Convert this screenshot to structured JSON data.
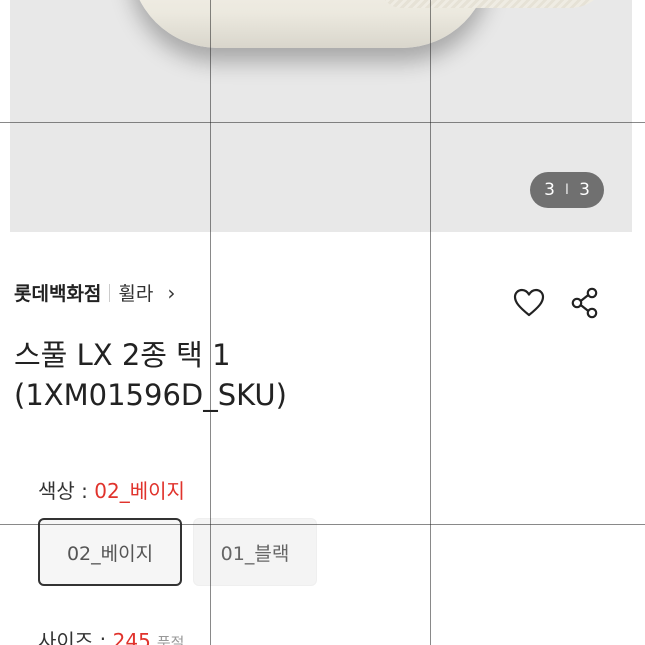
{
  "gallery": {
    "image_alt": "beige slipper product photo",
    "pager": {
      "current": "3",
      "separator": "I",
      "total": "3"
    }
  },
  "product": {
    "brand": "롯데백화점",
    "sub_brand": "휠라",
    "brand_chevron": "›",
    "title_line1": "스풀 LX 2종 택 1",
    "title_line2": "(1XM01596D_SKU)"
  },
  "actions": {
    "wishlist_icon": "heart-icon",
    "share_icon": "share-icon"
  },
  "options": {
    "color_label": "색상 : ",
    "color_value": "02_베이지",
    "color_choices": [
      "02_베이지",
      "01_블랙"
    ],
    "size_label": "사이즈 : ",
    "size_value": "245",
    "size_note": "품절"
  },
  "colors": {
    "accent_red": "#e0332c",
    "pager_bg": "#5a5a5a"
  }
}
